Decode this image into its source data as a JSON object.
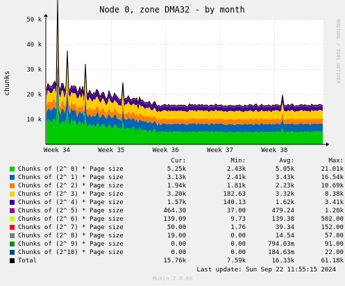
{
  "chart_data": {
    "type": "area",
    "title": "Node 0, zone DMA32 - by month",
    "ylabel": "chunks",
    "side_label": "RRDTOOL / TOBI OETIKER",
    "ylim": [
      0,
      50000
    ],
    "y_ticks": [
      10000,
      20000,
      30000,
      40000,
      50000
    ],
    "y_tick_labels": [
      "10 k",
      "20 k",
      "30 k",
      "40 k",
      "50 k"
    ],
    "x_ticks": [
      "Week 34",
      "Week 35",
      "Week 36",
      "Week 37",
      "Week 38"
    ],
    "grid": true,
    "series": [
      {
        "name": "Chunks of (2^ 0) * Page size",
        "color": "#00cc00",
        "cur": "5.25k",
        "min": "2.43k",
        "avg": "5.05k",
        "max": "21.01k",
        "base": 5050,
        "early": 1.9
      },
      {
        "name": "Chunks of (2^ 1) * Page size",
        "color": "#0066b3",
        "cur": "3.13k",
        "min": "2.41k",
        "avg": "3.43k",
        "max": "16.54k",
        "base": 3100,
        "early": 1.5
      },
      {
        "name": "Chunks of (2^ 2) * Page size",
        "color": "#ff8000",
        "cur": "1.94k",
        "min": "1.81k",
        "avg": "2.23k",
        "max": "10.69k",
        "base": 2000,
        "early": 1.5
      },
      {
        "name": "Chunks of (2^ 3) * Page size",
        "color": "#ffcc00",
        "cur": "3.20k",
        "min": "182.63",
        "avg": "3.32k",
        "max": "8.38k",
        "base": 3250,
        "early": 1.3
      },
      {
        "name": "Chunks of (2^ 4) * Page size",
        "color": "#330099",
        "cur": "1.57k",
        "min": "140.13",
        "avg": "1.62k",
        "max": "3.41k",
        "base": 1550,
        "early": 1.2
      },
      {
        "name": "Chunks of (2^ 5) * Page size",
        "color": "#990099",
        "cur": "464.30",
        "min": "37.00",
        "avg": "479.24",
        "max": "1.20k",
        "base": 470,
        "early": 1.2
      },
      {
        "name": "Chunks of (2^ 6) * Page size",
        "color": "#ccff00",
        "cur": "139.09",
        "min": "9.73",
        "avg": "139.38",
        "max": "502.00",
        "base": 140,
        "early": 1.2
      },
      {
        "name": "Chunks of (2^ 7) * Page size",
        "color": "#ff0000",
        "cur": "50.00",
        "min": "1.76",
        "avg": "39.34",
        "max": "152.00",
        "base": 45,
        "early": 1.0
      },
      {
        "name": "Chunks of (2^ 8) * Page size",
        "color": "#808080",
        "cur": "19.00",
        "min": "0.00",
        "avg": "14.54",
        "max": "57.00",
        "base": 17,
        "early": 1.0
      },
      {
        "name": "Chunks of (2^ 9) * Page size",
        "color": "#008f00",
        "cur": "0.00",
        "min": "0.00",
        "avg": "794.03m",
        "max": "91.00",
        "base": 0,
        "early": 1.0
      },
      {
        "name": "Chunks of (2^10) * Page size",
        "color": "#00487d",
        "cur": "0.00",
        "min": "0.00",
        "avg": "184.63m",
        "max": "22.00",
        "base": 0,
        "early": 1.0
      },
      {
        "name": "Total",
        "color": "#000000",
        "cur": "15.76k",
        "min": "7.59k",
        "avg": "16.33k",
        "max": "61.18k"
      }
    ]
  },
  "legend_headers": {
    "cur": "Cur:",
    "min": "Min:",
    "avg": "Avg:",
    "max": "Max:"
  },
  "last_update": "Last update: Sun Sep 22 11:55:15 2024",
  "footer": "Munin 2.0.66"
}
